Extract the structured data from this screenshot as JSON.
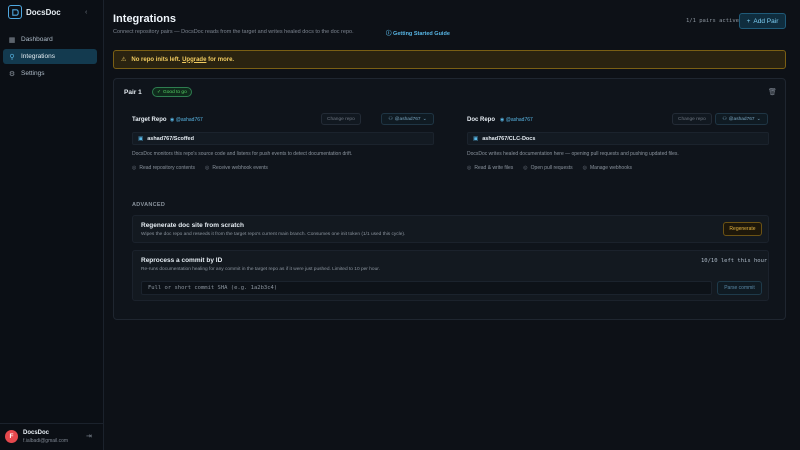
{
  "sidebar": {
    "brand": "DocsDoc",
    "items": [
      {
        "label": "Dashboard",
        "icon": "grid-icon"
      },
      {
        "label": "Integrations",
        "icon": "plug-icon",
        "active": true
      },
      {
        "label": "Settings",
        "icon": "gear-icon"
      }
    ],
    "user": {
      "initial": "F",
      "name": "DocsDoc",
      "email": "f.ialbadi@gmail.com"
    }
  },
  "header": {
    "title": "Integrations",
    "subtitle": "Connect repository pairs — DocsDoc reads from the target and writes healed docs to the doc repo.",
    "guide_link": "Getting Started Guide",
    "pairs_active": "1/1 pairs active",
    "add_pair": "Add Pair"
  },
  "warning": {
    "text": "No repo inits left.",
    "link": "Upgrade",
    "suffix": "for more."
  },
  "pair": {
    "title": "Pair 1",
    "status": "Good to go",
    "target": {
      "label": "Target Repo",
      "owner": "@ashad767",
      "change_label": "Change repo",
      "account": "@ashad767",
      "repo_name": "ashad767/Scoffed",
      "description": "DocsDoc monitors this repo's source code and listens for push events to detect documentation drift.",
      "permissions": [
        "Read repository contents",
        "Receive webhook events"
      ]
    },
    "doc": {
      "label": "Doc Repo",
      "owner": "@ashad767",
      "change_label": "Change repo",
      "account": "@ashad767",
      "repo_name": "ashad767/CLC-Docs",
      "description": "DocsDoc writes healed documentation here — opening pull requests and pushing updated files.",
      "permissions": [
        "Read & write files",
        "Open pull requests",
        "Manage webhooks"
      ]
    },
    "advanced": {
      "label": "ADVANCED",
      "regenerate": {
        "title": "Regenerate doc site from scratch",
        "description": "Wipes the doc repo and reseeds it from the target repo's current main branch. Consumes one init token (1/1 used this cycle).",
        "button": "Regenerate"
      },
      "reprocess": {
        "title": "Reprocess a commit by ID",
        "description": "Re-runs documentation healing for any commit in the target repo as if it were just pushed. Limited to 10 per hour.",
        "remaining": "10/10 left this hour",
        "placeholder": "Full or short commit SHA (e.g. 1a2b3c4)",
        "button": "Parse commit"
      }
    }
  },
  "colors": {
    "accent": "#58b7e6",
    "warning": "#f2cc60",
    "success": "#56d364"
  }
}
